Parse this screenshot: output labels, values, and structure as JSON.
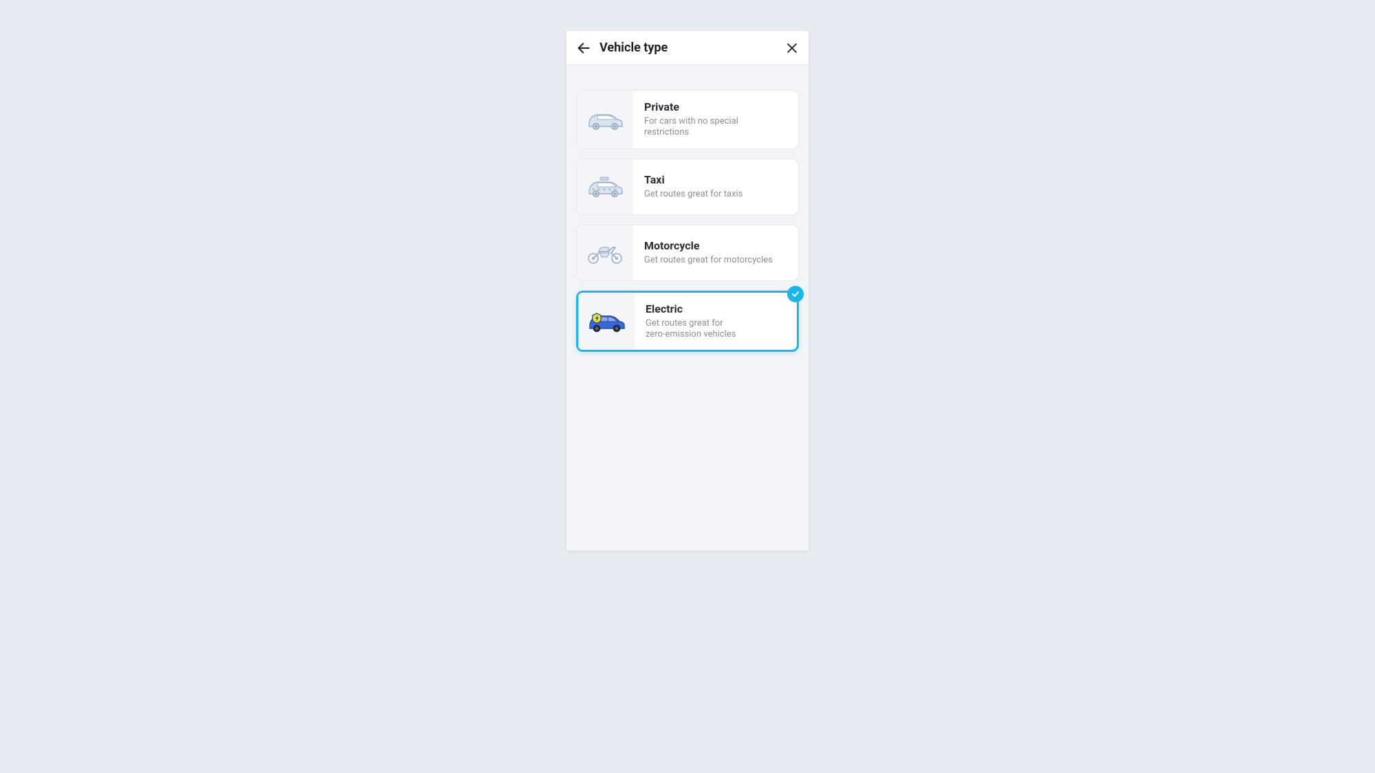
{
  "header": {
    "title": "Vehicle type"
  },
  "options": [
    {
      "id": "private",
      "name": "Private",
      "desc": "For cars with no special\nrestrictions",
      "selected": false
    },
    {
      "id": "taxi",
      "name": "Taxi",
      "desc": "Get routes great for taxis",
      "selected": false
    },
    {
      "id": "motorcycle",
      "name": "Motorcycle",
      "desc": "Get routes great for motorcycles",
      "selected": false
    },
    {
      "id": "electric",
      "name": "Electric",
      "desc": "Get routes great for\nzero-emission vehicles",
      "selected": true
    }
  ],
  "colors": {
    "accent": "#19b6e9",
    "car_light_body": "#dbe5f0",
    "car_light_stroke": "#9cb0cb",
    "car_blue_body": "#3a67d6",
    "car_blue_dark": "#254aa5",
    "bolt_badge": "#f2e90f"
  }
}
